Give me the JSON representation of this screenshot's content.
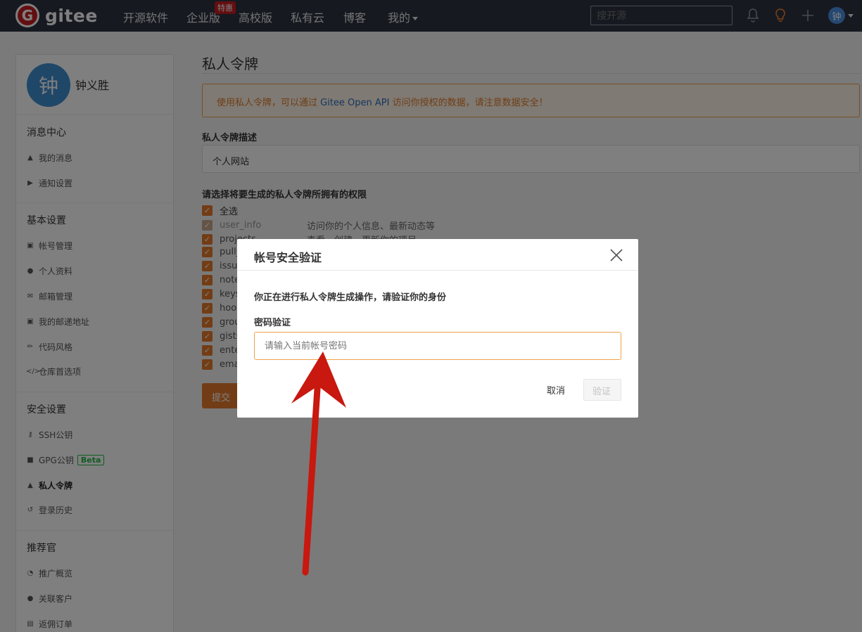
{
  "nav": {
    "logo_text": "gitee",
    "logo_mark": "G",
    "items": [
      "开源软件",
      "企业版",
      "高校版",
      "私有云",
      "博客",
      "我的"
    ],
    "badge": "特惠",
    "search_placeholder": "搜开源",
    "avatar_char": "钟"
  },
  "sidebar": {
    "avatar_char": "钟",
    "username": "钟义胜",
    "sections": [
      {
        "title": "消息中心",
        "items": [
          {
            "label": "我的消息",
            "icon": "bell-icon"
          },
          {
            "label": "通知设置",
            "icon": "volume-icon"
          }
        ]
      },
      {
        "title": "基本设置",
        "items": [
          {
            "label": "帐号管理",
            "icon": "id-card-icon"
          },
          {
            "label": "个人资料",
            "icon": "user-icon"
          },
          {
            "label": "邮箱管理",
            "icon": "mail-icon"
          },
          {
            "label": "我的邮递地址",
            "icon": "address-card-icon"
          },
          {
            "label": "代码风格",
            "icon": "brush-icon"
          },
          {
            "label": "仓库首选项",
            "icon": "code-icon"
          }
        ]
      },
      {
        "title": "安全设置",
        "items": [
          {
            "label": "SSH公钥",
            "icon": "key-icon"
          },
          {
            "label": "GPG公钥",
            "icon": "lock-icon",
            "badge": "Beta"
          },
          {
            "label": "私人令牌",
            "icon": "token-icon",
            "active": true
          },
          {
            "label": "登录历史",
            "icon": "history-icon"
          }
        ]
      },
      {
        "title": "推荐官",
        "items": [
          {
            "label": "推广概览",
            "icon": "dashboard-icon"
          },
          {
            "label": "关联客户",
            "icon": "user-link-icon"
          },
          {
            "label": "返佣订单",
            "icon": "order-icon"
          }
        ]
      }
    ]
  },
  "main": {
    "title": "私人令牌",
    "alert_prefix": "使用私人令牌，可以通过 ",
    "alert_api": "Gitee Open API",
    "alert_suffix": " 访问你授权的数据，请注意数据安全！",
    "desc_label": "私人令牌描述",
    "desc_value": "个人网站",
    "perm_label": "请选择将要生成的私人令牌所拥有的权限",
    "select_all": "全选",
    "permissions": [
      {
        "name": "user_info",
        "desc": "访问你的个人信息、最新动态等",
        "dim": true
      },
      {
        "name": "projects",
        "desc": "查看、创建、更新你的项目"
      },
      {
        "name": "pull_requests",
        "desc": ""
      },
      {
        "name": "issues",
        "desc": ""
      },
      {
        "name": "notes",
        "desc": ""
      },
      {
        "name": "keys",
        "desc": ""
      },
      {
        "name": "hook",
        "desc": ""
      },
      {
        "name": "groups",
        "desc": ""
      },
      {
        "name": "gists",
        "desc": ""
      },
      {
        "name": "enterprises",
        "desc": ""
      },
      {
        "name": "emails",
        "desc": ""
      }
    ],
    "submit": "提交"
  },
  "modal": {
    "title": "帐号安全验证",
    "message": "你正在进行私人令牌生成操作，请验证你的身份",
    "label": "密码验证",
    "placeholder": "请输入当前帐号密码",
    "cancel": "取消",
    "verify": "验证"
  },
  "colors": {
    "nav_bg": "#2c3241",
    "accent": "#e47b2c",
    "brand": "#c71d23",
    "arrow": "#c8180f"
  }
}
